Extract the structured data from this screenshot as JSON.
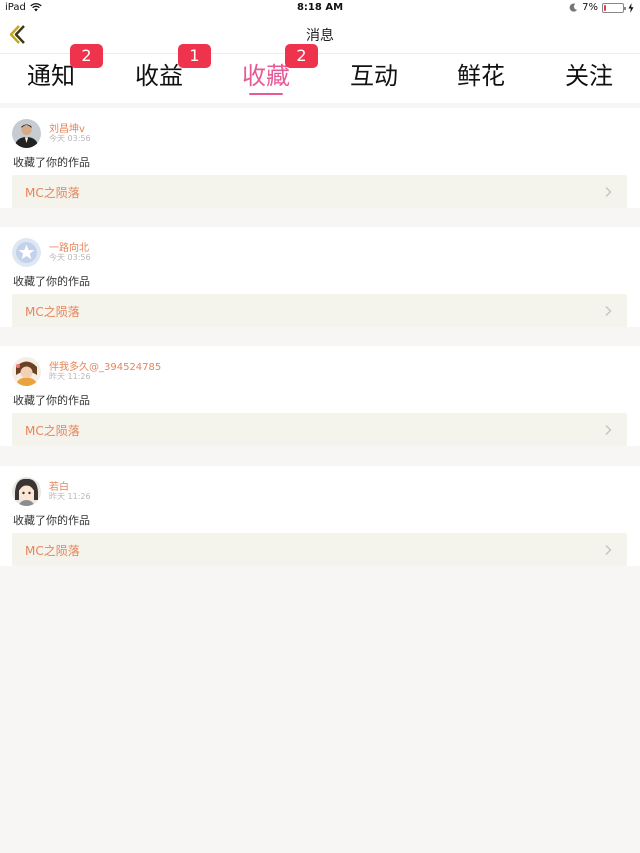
{
  "status_bar": {
    "device": "iPad",
    "time": "8:18 AM",
    "battery_percent": "7%",
    "battery_level": 0.07
  },
  "nav": {
    "title": "消息"
  },
  "tabs": [
    {
      "label": "通知",
      "badge": "2"
    },
    {
      "label": "收益",
      "badge": "1"
    },
    {
      "label": "收藏",
      "badge": "2",
      "active": true
    },
    {
      "label": "互动",
      "badge": ""
    },
    {
      "label": "鲜花",
      "badge": ""
    },
    {
      "label": "关注",
      "badge": ""
    }
  ],
  "items": [
    {
      "user": "刘昌坤v",
      "time": "今天 03:56",
      "action": "收藏了你的作品",
      "work": "MC之陨落"
    },
    {
      "user": "一路向北",
      "time": "今天 03:56",
      "action": "收藏了你的作品",
      "work": "MC之陨落"
    },
    {
      "user": "伴我多久@_394524785",
      "time": "昨天 11:26",
      "action": "收藏了你的作品",
      "work": "MC之陨落"
    },
    {
      "user": "若白",
      "time": "昨天 11:26",
      "action": "收藏了你的作品",
      "work": "MC之陨落"
    }
  ],
  "colors": {
    "accent": "#e75a96",
    "badge": "#f0334c",
    "link": "#e6855a",
    "link_bg": "#f4f3ec",
    "page_bg": "#f7f6f5"
  }
}
